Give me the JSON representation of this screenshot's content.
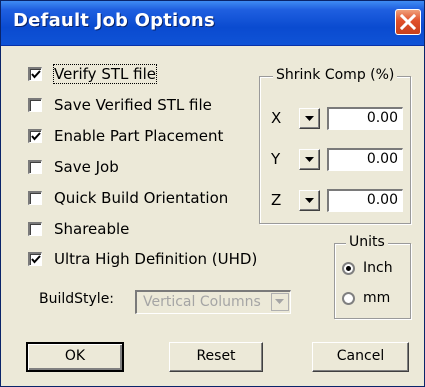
{
  "window": {
    "title": "Default Job Options"
  },
  "options": [
    {
      "label": "Verify STL file",
      "checked": true
    },
    {
      "label": "Save Verified STL file",
      "checked": false
    },
    {
      "label": "Enable Part Placement",
      "checked": true
    },
    {
      "label": "Save Job",
      "checked": false
    },
    {
      "label": "Quick Build Orientation",
      "checked": false
    },
    {
      "label": "Shareable",
      "checked": false
    },
    {
      "label": "Ultra High Definition (UHD)",
      "checked": true
    }
  ],
  "shrink": {
    "title": "Shrink Comp (%)",
    "x_label": "X",
    "x_value": "0.00",
    "y_label": "Y",
    "y_value": "0.00",
    "z_label": "Z",
    "z_value": "0.00"
  },
  "units": {
    "title": "Units",
    "inch": "Inch",
    "mm": "mm",
    "selected": "Inch"
  },
  "buildstyle": {
    "label": "BuildStyle:",
    "value": "Vertical Columns",
    "enabled": false
  },
  "buttons": {
    "ok": "OK",
    "reset": "Reset",
    "cancel": "Cancel"
  },
  "colors": {
    "title_bar": "#0a4bd0",
    "close_button": "#e0502a",
    "dialog_bg": "#ece9d8",
    "disabled_text": "#a5a5a5"
  }
}
